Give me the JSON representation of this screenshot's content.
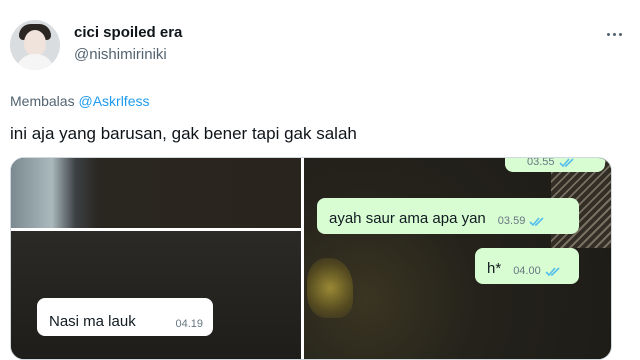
{
  "user": {
    "display_name": "cici spoiled era",
    "handle": "@nishimiriniki"
  },
  "reply": {
    "prefix": "Membalas",
    "mention": "@Askrlfess"
  },
  "tweet": {
    "text": "ini aja yang barusan, gak bener tapi gak salah"
  },
  "chat": {
    "messages": [
      {
        "direction": "outgoing",
        "text": "",
        "time": "03.55",
        "read": true
      },
      {
        "direction": "outgoing",
        "text": "ayah saur ama apa yan",
        "time": "03.59",
        "read": true
      },
      {
        "direction": "outgoing",
        "text": "h*",
        "time": "04.00",
        "read": true
      },
      {
        "direction": "incoming",
        "text": "Nasi ma lauk",
        "time": "04.19",
        "read": false
      }
    ]
  },
  "colors": {
    "mention": "#1d9bf0",
    "outgoing_bubble": "#d9fdd3",
    "incoming_bubble": "#ffffff",
    "read_ticks": "#53bdeb"
  },
  "icons": {
    "more": "more-horizontal-icon",
    "read_receipt": "double-check-icon"
  }
}
